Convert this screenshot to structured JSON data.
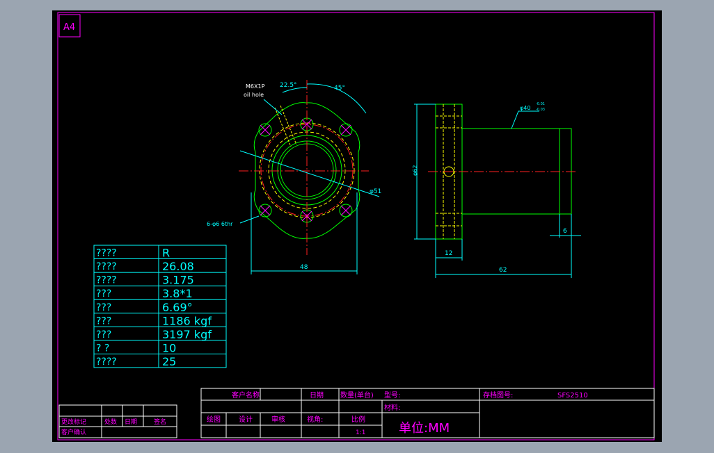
{
  "sheet": {
    "size_label": "A4"
  },
  "front_view": {
    "thread_callout_line1": "M6X1P",
    "thread_callout_line2": "oil hole",
    "angle_small": "22.5°",
    "angle_large": "45°",
    "diameter_bolt_circle": "φ51",
    "holes_callout": "6-φ6 6thr",
    "width_dim": "48"
  },
  "side_view": {
    "outer_diameter": "φ40",
    "tol_upper": "-0.01",
    "tol_lower": "-0.03",
    "flange_diameter": "φ62",
    "end_length": "6",
    "flange_thickness": "12",
    "total_length": "62"
  },
  "spec_table": {
    "rows": [
      {
        "label": "????",
        "value": "R"
      },
      {
        "label": "????",
        "value": "26.08"
      },
      {
        "label": "????",
        "value": "3.175"
      },
      {
        "label": "???",
        "value": "3.8*1"
      },
      {
        "label": "???",
        "value": "6.69°"
      },
      {
        "label": "???",
        "value": "1186 kgf"
      },
      {
        "label": "???",
        "value": "3197 kgf"
      },
      {
        "label": "?  ?",
        "value": "10"
      },
      {
        "label": "????",
        "value": "25"
      }
    ]
  },
  "revision_block": {
    "change_mark": "更改标记",
    "count": "处数",
    "date": "日期",
    "sign": "签名",
    "customer_confirm": "客户确认"
  },
  "title_block": {
    "customer_name": "客户名称",
    "date": "日期",
    "quantity": "数量(单台)",
    "model": "型号:",
    "archive_no": "存档图号:",
    "drawing_no": "SFS2510",
    "material": "材料:",
    "drawn": "绘图",
    "design": "设计",
    "review": "审核",
    "view_angle": "视角:",
    "scale_label": "比例",
    "scale_value": "1:1",
    "unit": "单位:MM"
  },
  "colors": {
    "background": "#000000",
    "frame": "#ff00ff",
    "dimension": "#00ffff",
    "outline": "#00ff00",
    "hidden": "#ffff00",
    "center": "#ff2020",
    "page": "#9ba5b1"
  }
}
